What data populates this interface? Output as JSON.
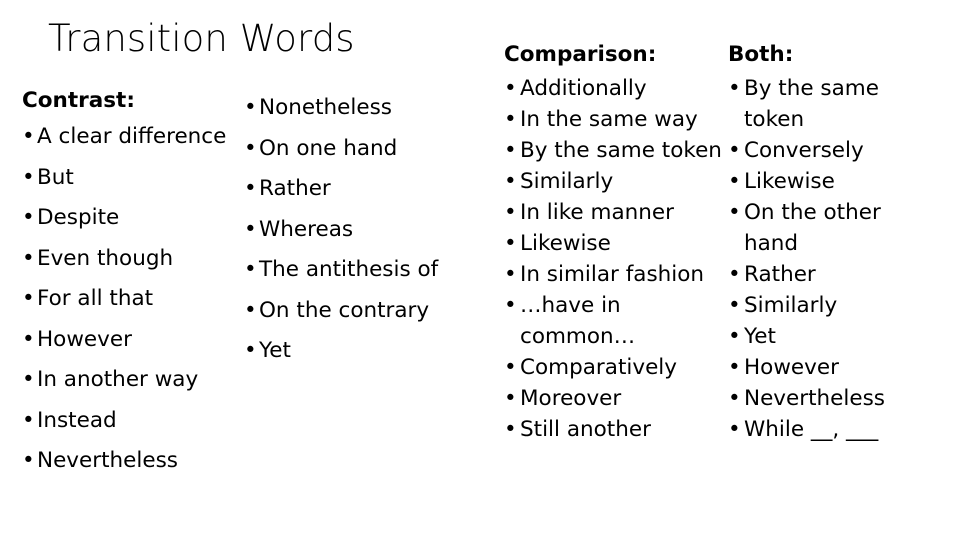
{
  "slide": {
    "title": "Transition Words",
    "background_color": "#ffffff",
    "text_color": "#000000",
    "bullet_glyph": "•"
  },
  "contrast": {
    "header": "Contrast:",
    "column_a": [
      "A clear difference",
      "But",
      "Despite",
      "Even though",
      "For all that",
      "However",
      "In another way",
      "Instead",
      "Nevertheless"
    ],
    "column_b": [
      "Nonetheless",
      "On one hand",
      "Rather",
      "Whereas",
      "The antithesis of",
      "On the contrary",
      "Yet"
    ]
  },
  "comparison": {
    "header": "Comparison:",
    "items": [
      "Additionally",
      "In the same way",
      "By the same token",
      "Similarly",
      "In like manner",
      "Likewise",
      "In similar fashion",
      "…have in common…",
      "Comparatively",
      "Moreover",
      "Still another"
    ]
  },
  "both": {
    "header": "Both:",
    "items": [
      "By the same token",
      "Conversely",
      "Likewise",
      "On the other hand",
      "Rather",
      "Similarly",
      "Yet",
      "However",
      "Nevertheless",
      "While __, ___"
    ]
  }
}
